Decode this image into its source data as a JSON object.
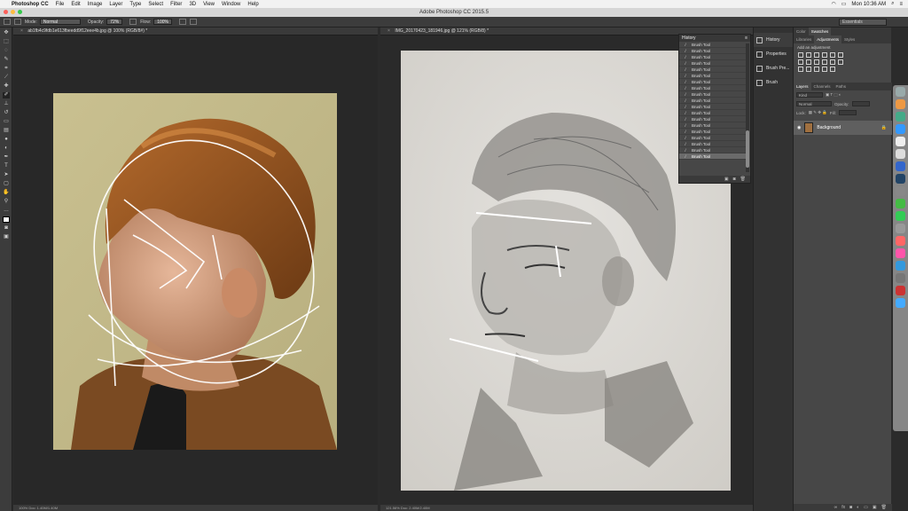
{
  "menubar": {
    "app": "Photoshop CC",
    "items": [
      "File",
      "Edit",
      "Image",
      "Layer",
      "Type",
      "Select",
      "Filter",
      "3D",
      "View",
      "Window",
      "Help"
    ],
    "clock": "Mon 10:36 AM"
  },
  "titlebar": {
    "title": "Adobe Photoshop CC 2015.5"
  },
  "options": {
    "mode_label": "Mode:",
    "mode_value": "Normal",
    "opacity_label": "Opacity:",
    "opacity_value": "72%",
    "flow_label": "Flow:",
    "flow_value": "100%",
    "workspace": "Essentials"
  },
  "doc1": {
    "tab": "ab1fb4c9fdb1e613fbeedd9f12eee4b.jpg @ 100% (RGB/8#) *",
    "status": "100%   Doc: 1.40M/1.40M"
  },
  "doc2": {
    "tab": "IMG_20170423_181946.jpg @ 121% (RGB/8) *",
    "status": "121.56%   Doc: 2.40M/2.40M"
  },
  "history": {
    "title": "History",
    "items": [
      "Brush Tool",
      "Brush Tool",
      "Brush Tool",
      "Brush Tool",
      "Brush Tool",
      "Brush Tool",
      "Brush Tool",
      "Brush Tool",
      "Brush Tool",
      "Brush Tool",
      "Brush Tool",
      "Brush Tool",
      "Brush Tool",
      "Brush Tool",
      "Brush Tool",
      "Brush Tool",
      "Brush Tool",
      "Brush Tool",
      "Brush Tool"
    ]
  },
  "dock": {
    "items": [
      "History",
      "Properties",
      "Brush Pre...",
      "Brush"
    ]
  },
  "panels": {
    "top_tabs": [
      "Color",
      "Swatches"
    ],
    "adj_tabs": [
      "Libraries",
      "Adjustments",
      "Styles"
    ],
    "adj_label": "Add an adjustment",
    "layer_tabs": [
      "Layers",
      "Channels",
      "Paths"
    ],
    "kind_label": "Kind",
    "blend_label": "Normal",
    "opacity_label": "Opacity:",
    "lock_label": "Lock:",
    "fill_label": "Fill:",
    "layer_name": "Background"
  },
  "colors": {
    "accent": "#3a3a3a",
    "selected_row": "#6a6a6a"
  }
}
